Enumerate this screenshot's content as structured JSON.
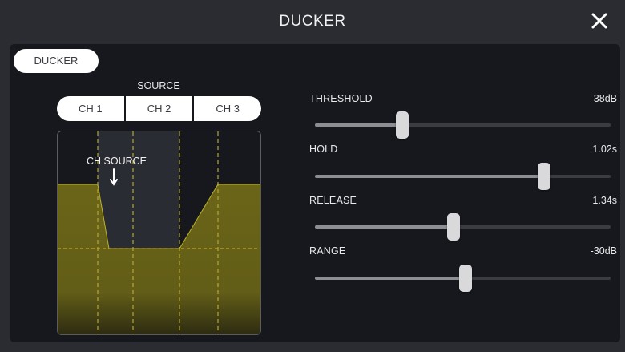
{
  "header": {
    "title": "DUCKER",
    "close_icon": "close-icon"
  },
  "tabs": [
    {
      "label": "DUCKER",
      "selected": true
    }
  ],
  "source": {
    "label": "SOURCE",
    "options": [
      "CH 1",
      "CH 2",
      "CH 3"
    ],
    "selected": "CH 2"
  },
  "graph": {
    "ch_source_label": "CH SOURCE",
    "arrow_icon": "down-arrow-icon",
    "fill_color": "#6b6518",
    "line_color": "#b7a82c"
  },
  "params": [
    {
      "label": "THRESHOLD",
      "value": "-38dB",
      "fraction": 0.295
    },
    {
      "label": "HOLD",
      "value": "1.02s",
      "fraction": 0.775
    },
    {
      "label": "RELEASE",
      "value": "1.34s",
      "fraction": 0.47
    },
    {
      "label": "RANGE",
      "value": "-30dB",
      "fraction": 0.51
    }
  ],
  "colors": {
    "background": "#2a2c31",
    "panel": "#16181d",
    "button_bg": "#ffffff"
  }
}
